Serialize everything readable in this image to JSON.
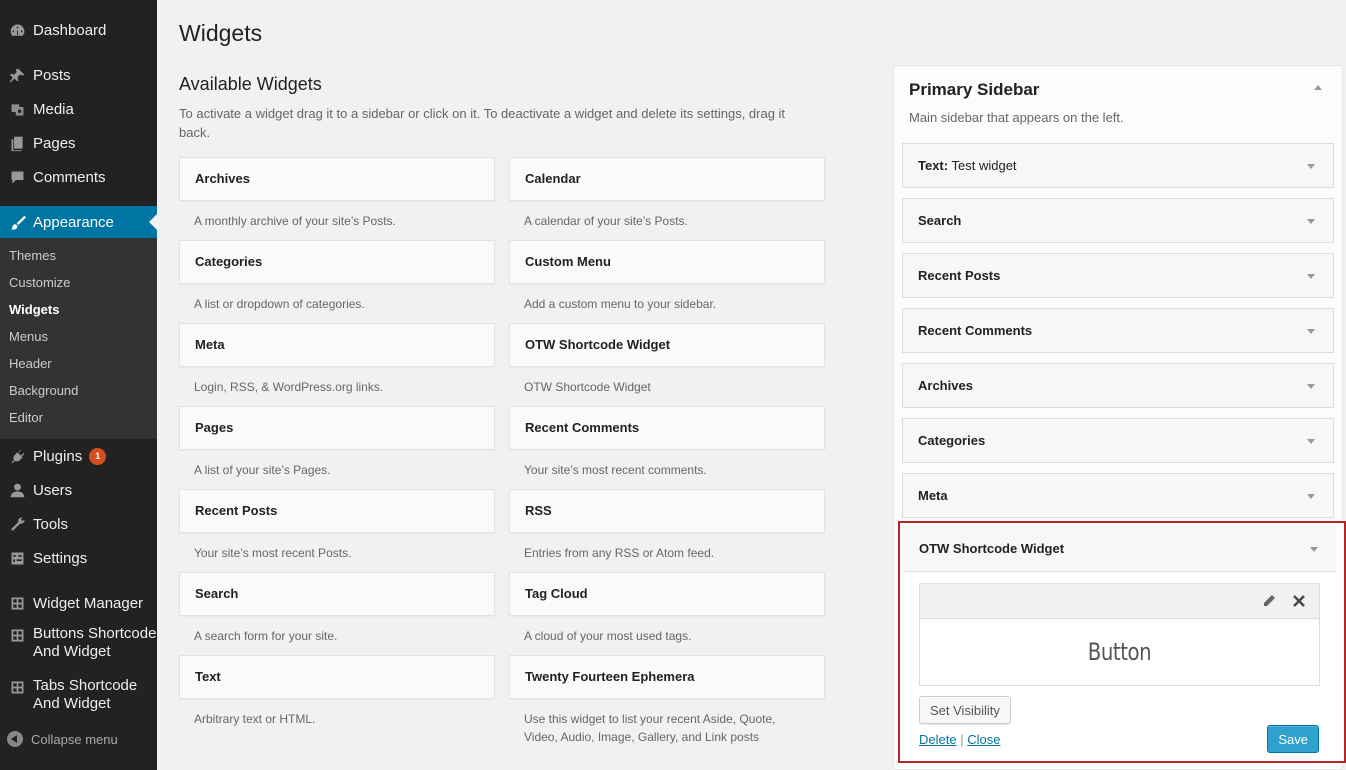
{
  "menu": {
    "dashboard": "Dashboard",
    "posts": "Posts",
    "media": "Media",
    "pages": "Pages",
    "comments": "Comments",
    "appearance": "Appearance",
    "submenu": [
      "Themes",
      "Customize",
      "Widgets",
      "Menus",
      "Header",
      "Background",
      "Editor"
    ],
    "plugins": "Plugins",
    "plugins_badge": "1",
    "users": "Users",
    "tools": "Tools",
    "settings": "Settings",
    "widget_manager": "Widget Manager",
    "buttons_shortcode": "Buttons Shortcode And Widget",
    "tabs_shortcode": "Tabs Shortcode And Widget",
    "collapse": "Collapse menu"
  },
  "page": {
    "title": "Widgets",
    "available_title": "Available Widgets",
    "available_desc": "To activate a widget drag it to a sidebar or click on it. To deactivate a widget and delete its settings, drag it back."
  },
  "widgets": [
    {
      "title": "Archives",
      "desc": "A monthly archive of your site’s Posts."
    },
    {
      "title": "Calendar",
      "desc": "A calendar of your site’s Posts."
    },
    {
      "title": "Categories",
      "desc": "A list or dropdown of categories."
    },
    {
      "title": "Custom Menu",
      "desc": "Add a custom menu to your sidebar."
    },
    {
      "title": "Meta",
      "desc": "Login, RSS, & WordPress.org links."
    },
    {
      "title": "OTW Shortcode Widget",
      "desc": "OTW Shortcode Widget"
    },
    {
      "title": "Pages",
      "desc": "A list of your site’s Pages."
    },
    {
      "title": "Recent Comments",
      "desc": "Your site’s most recent comments."
    },
    {
      "title": "Recent Posts",
      "desc": "Your site’s most recent Posts."
    },
    {
      "title": "RSS",
      "desc": "Entries from any RSS or Atom feed."
    },
    {
      "title": "Search",
      "desc": "A search form for your site."
    },
    {
      "title": "Tag Cloud",
      "desc": "A cloud of your most used tags."
    },
    {
      "title": "Text",
      "desc": "Arbitrary text or HTML."
    },
    {
      "title": "Twenty Fourteen Ephemera",
      "desc": "Use this widget to list your recent Aside, Quote, Video, Audio, Image, Gallery, and Link posts"
    }
  ],
  "sidebar": {
    "title": "Primary Sidebar",
    "desc": "Main sidebar that appears on the left.",
    "text_widget_name": "Text:",
    "text_widget_title": "Test widget",
    "widgets": [
      "Search",
      "Recent Posts",
      "Recent Comments",
      "Archives",
      "Categories",
      "Meta"
    ],
    "open_widget": {
      "title": "OTW Shortcode Widget",
      "preview_text": "Button",
      "set_visibility": "Set Visibility",
      "delete": "Delete",
      "separator": "|",
      "close": "Close",
      "save": "Save"
    }
  },
  "icons": {
    "edit": "pencil-icon",
    "remove": "close-icon"
  }
}
